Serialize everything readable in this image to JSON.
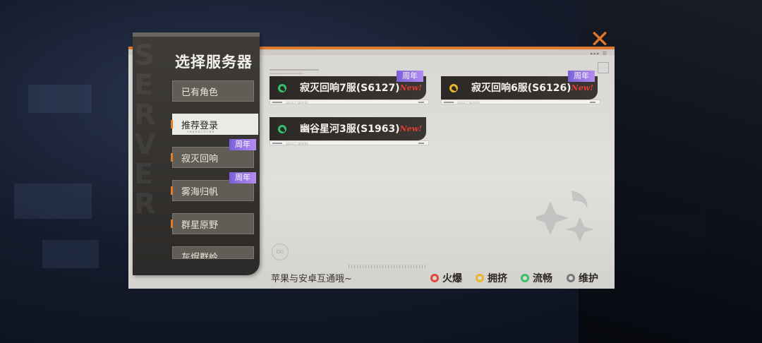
{
  "sidebar": {
    "title": "选择服务器",
    "watermark": "SERVER",
    "items": [
      {
        "label": "已有角色",
        "badge": ""
      },
      {
        "label": "推荐登录",
        "badge": "",
        "sub": "PREFECTURE"
      },
      {
        "label": "寂灭回响",
        "badge": "周年"
      },
      {
        "label": "雾海归帆",
        "badge": "周年"
      },
      {
        "label": "群星原野",
        "badge": ""
      },
      {
        "label": "灰烬群岭",
        "badge": ""
      }
    ]
  },
  "servers": [
    {
      "name": "寂灭回响7服(S6127)",
      "status": "green",
      "new": "New!",
      "badge": "周年"
    },
    {
      "name": "寂灭回响6服(S6126)",
      "status": "yellow",
      "new": "New!",
      "badge": "周年"
    },
    {
      "name": "幽谷星河3服(S1963)",
      "status": "green",
      "new": "New!",
      "badge": ""
    }
  ],
  "footer": {
    "note": "苹果与安卓互通哦~"
  },
  "legend": [
    {
      "label": "火爆",
      "color": "#e2463a"
    },
    {
      "label": "拥挤",
      "color": "#e8b62a"
    },
    {
      "label": "流畅",
      "color": "#35c06a"
    },
    {
      "label": "维护",
      "color": "#777777"
    }
  ],
  "icons": {
    "close": "✕"
  }
}
